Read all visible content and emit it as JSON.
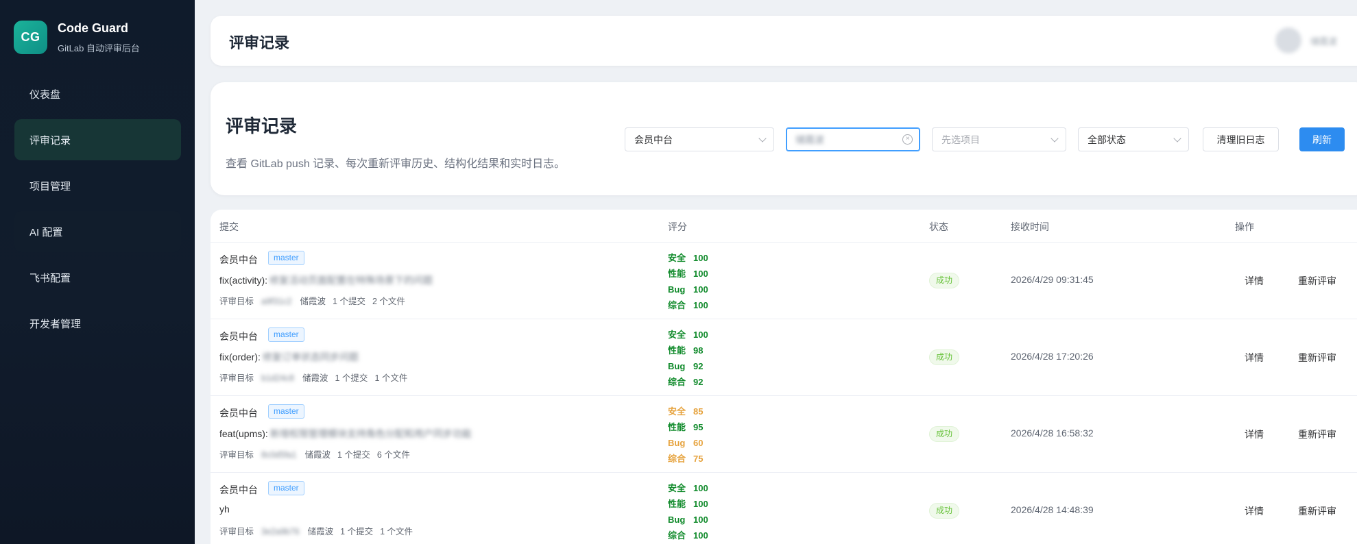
{
  "brand": {
    "logo": "CG",
    "title": "Code Guard",
    "subtitle": "GitLab 自动评审后台"
  },
  "sidebar": {
    "items": [
      {
        "label": "仪表盘"
      },
      {
        "label": "评审记录"
      },
      {
        "label": "项目管理"
      },
      {
        "label": "AI 配置"
      },
      {
        "label": "飞书配置"
      },
      {
        "label": "开发者管理"
      }
    ]
  },
  "header": {
    "title": "评审记录",
    "username": "储霞波"
  },
  "page": {
    "title": "评审记录",
    "description": "查看 GitLab push 记录、每次重新评审历史、结构化结果和实时日志。"
  },
  "filters": {
    "group": "会员中台",
    "developer": "储霞波",
    "project_placeholder": "先选项目",
    "status": "全部状态",
    "clean_label": "清理旧日志",
    "refresh_label": "刷新"
  },
  "table": {
    "headers": [
      "提交",
      "评分",
      "状态",
      "接收时间",
      "操作"
    ],
    "rows": [
      {
        "project": "会员中台",
        "branch": "master",
        "commit_prefix": "fix(activity):",
        "commit_msg": "修复活动页面配置在特殊场景下的问题",
        "target_label": "评审目标",
        "target": "a9f31c2",
        "author": "储霞波",
        "commits": "1 个提交",
        "files": "2 个文件",
        "scores": [
          {
            "label": "安全",
            "value": "100"
          },
          {
            "label": "性能",
            "value": "100"
          },
          {
            "label": "Bug",
            "value": "100"
          },
          {
            "label": "综合",
            "value": "100"
          }
        ],
        "status": "成功",
        "time": "2026/4/29 09:31:45",
        "detail": "详情",
        "rereview": "重新评审"
      },
      {
        "project": "会员中台",
        "branch": "master",
        "commit_prefix": "fix(order):",
        "commit_msg": "修复订单状态同步问题",
        "target_label": "评审目标",
        "target": "b1d24c8",
        "author": "储霞波",
        "commits": "1 个提交",
        "files": "1 个文件",
        "scores": [
          {
            "label": "安全",
            "value": "100"
          },
          {
            "label": "性能",
            "value": "98"
          },
          {
            "label": "Bug",
            "value": "92"
          },
          {
            "label": "综合",
            "value": "92"
          }
        ],
        "status": "成功",
        "time": "2026/4/28 17:20:26",
        "detail": "详情",
        "rereview": "重新评审"
      },
      {
        "project": "会员中台",
        "branch": "master",
        "commit_prefix": "feat(upms):",
        "commit_msg": "新增权限管理模块支持角色分配和用户同步功能",
        "target_label": "评审目标",
        "target": "8c0d5fa1",
        "author": "储霞波",
        "commits": "1 个提交",
        "files": "6 个文件",
        "scores": [
          {
            "label": "安全",
            "value": "85"
          },
          {
            "label": "性能",
            "value": "95"
          },
          {
            "label": "Bug",
            "value": "60"
          },
          {
            "label": "综合",
            "value": "75"
          }
        ],
        "status": "成功",
        "time": "2026/4/28 16:58:32",
        "detail": "详情",
        "rereview": "重新评审"
      },
      {
        "project": "会员中台",
        "branch": "master",
        "commit_prefix": "yh",
        "commit_msg": "",
        "target_label": "评审目标",
        "target": "3e2a9b76",
        "author": "储霞波",
        "commits": "1 个提交",
        "files": "1 个文件",
        "scores": [
          {
            "label": "安全",
            "value": "100"
          },
          {
            "label": "性能",
            "value": "100"
          },
          {
            "label": "Bug",
            "value": "100"
          },
          {
            "label": "综合",
            "value": "100"
          }
        ],
        "status": "成功",
        "time": "2026/4/28 14:48:39",
        "detail": "详情",
        "rereview": "重新评审"
      }
    ]
  },
  "colors": {
    "accent": "#2d8cf0",
    "score_ok": "#0f8a2a",
    "score_warn": "#e6a23c",
    "success": "#67c23a",
    "brand": "#1bb39a"
  }
}
